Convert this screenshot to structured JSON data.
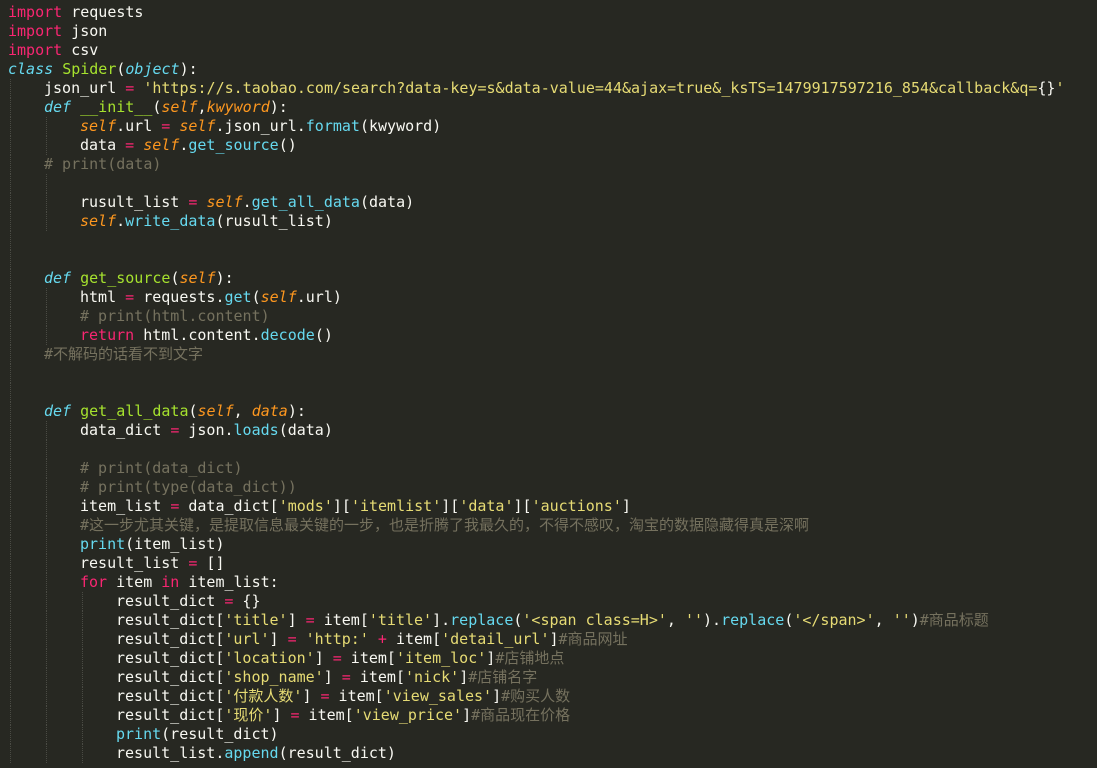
{
  "editor": {
    "theme": "monokai",
    "colors": {
      "background": "#272822",
      "plain": "#f8f8f2",
      "keyword": "#f92672",
      "string": "#e6db74",
      "comment": "#75715e",
      "function": "#a6e22e",
      "builtin": "#66d9ef",
      "parameter": "#fd971f"
    },
    "lines": [
      {
        "indent": 0,
        "tokens": [
          [
            "kw",
            "import"
          ],
          [
            "pl",
            " requests"
          ]
        ]
      },
      {
        "indent": 0,
        "tokens": [
          [
            "kw",
            "import"
          ],
          [
            "pl",
            " json"
          ]
        ]
      },
      {
        "indent": 0,
        "tokens": [
          [
            "kw",
            "import"
          ],
          [
            "pl",
            " csv"
          ]
        ]
      },
      {
        "indent": 0,
        "tokens": [
          [
            "df",
            "class"
          ],
          [
            "pl",
            " "
          ],
          [
            "fn",
            "Spider"
          ],
          [
            "pl",
            "("
          ],
          [
            "ty",
            "object"
          ],
          [
            "pl",
            "):"
          ]
        ]
      },
      {
        "indent": 1,
        "tokens": [
          [
            "pl",
            "json_url "
          ],
          [
            "op",
            "="
          ],
          [
            "pl",
            " "
          ],
          [
            "st",
            "'https://s.taobao.com/search?data-key=s&data-value=44&ajax=true&_ksTS=1479917597216_854&callback&q="
          ],
          [
            "pl",
            "{}"
          ],
          [
            "st",
            "'"
          ]
        ]
      },
      {
        "indent": 1,
        "tokens": [
          [
            "df",
            "def"
          ],
          [
            "pl",
            " "
          ],
          [
            "fn",
            "__init__"
          ],
          [
            "pl",
            "("
          ],
          [
            "sf",
            "self"
          ],
          [
            "pl",
            ","
          ],
          [
            "pa",
            "kwyword"
          ],
          [
            "pl",
            "):"
          ]
        ]
      },
      {
        "indent": 2,
        "tokens": [
          [
            "sf",
            "self"
          ],
          [
            "pl",
            ".url "
          ],
          [
            "op",
            "="
          ],
          [
            "pl",
            " "
          ],
          [
            "sf",
            "self"
          ],
          [
            "pl",
            ".json_url."
          ],
          [
            "bi",
            "format"
          ],
          [
            "pl",
            "(kwyword)"
          ]
        ]
      },
      {
        "indent": 2,
        "tokens": [
          [
            "pl",
            "data "
          ],
          [
            "op",
            "="
          ],
          [
            "pl",
            " "
          ],
          [
            "sf",
            "self"
          ],
          [
            "pl",
            "."
          ],
          [
            "bi",
            "get_source"
          ],
          [
            "pl",
            "()"
          ]
        ]
      },
      {
        "indent": 1,
        "tokens": [
          [
            "cm",
            "# print(data)"
          ]
        ]
      },
      {
        "indent": 2,
        "tokens": []
      },
      {
        "indent": 2,
        "tokens": [
          [
            "pl",
            "rusult_list "
          ],
          [
            "op",
            "="
          ],
          [
            "pl",
            " "
          ],
          [
            "sf",
            "self"
          ],
          [
            "pl",
            "."
          ],
          [
            "bi",
            "get_all_data"
          ],
          [
            "pl",
            "(data)"
          ]
        ]
      },
      {
        "indent": 2,
        "tokens": [
          [
            "sf",
            "self"
          ],
          [
            "pl",
            "."
          ],
          [
            "bi",
            "write_data"
          ],
          [
            "pl",
            "(rusult_list)"
          ]
        ]
      },
      {
        "indent": 1,
        "tokens": []
      },
      {
        "indent": 1,
        "tokens": []
      },
      {
        "indent": 1,
        "tokens": [
          [
            "df",
            "def"
          ],
          [
            "pl",
            " "
          ],
          [
            "fn",
            "get_source"
          ],
          [
            "pl",
            "("
          ],
          [
            "sf",
            "self"
          ],
          [
            "pl",
            "):"
          ]
        ]
      },
      {
        "indent": 2,
        "tokens": [
          [
            "pl",
            "html "
          ],
          [
            "op",
            "="
          ],
          [
            "pl",
            " requests."
          ],
          [
            "bi",
            "get"
          ],
          [
            "pl",
            "("
          ],
          [
            "sf",
            "self"
          ],
          [
            "pl",
            ".url)"
          ]
        ]
      },
      {
        "indent": 2,
        "tokens": [
          [
            "cm",
            "# print(html.content)"
          ]
        ]
      },
      {
        "indent": 2,
        "tokens": [
          [
            "kw",
            "return"
          ],
          [
            "pl",
            " html.content."
          ],
          [
            "bi",
            "decode"
          ],
          [
            "pl",
            "()"
          ]
        ]
      },
      {
        "indent": 1,
        "tokens": [
          [
            "cm",
            "#不解码的话看不到文字"
          ]
        ]
      },
      {
        "indent": 1,
        "tokens": []
      },
      {
        "indent": 1,
        "tokens": []
      },
      {
        "indent": 1,
        "tokens": [
          [
            "df",
            "def"
          ],
          [
            "pl",
            " "
          ],
          [
            "fn",
            "get_all_data"
          ],
          [
            "pl",
            "("
          ],
          [
            "sf",
            "self"
          ],
          [
            "pl",
            ", "
          ],
          [
            "pa",
            "data"
          ],
          [
            "pl",
            "):"
          ]
        ]
      },
      {
        "indent": 2,
        "tokens": [
          [
            "pl",
            "data_dict "
          ],
          [
            "op",
            "="
          ],
          [
            "pl",
            " json."
          ],
          [
            "bi",
            "loads"
          ],
          [
            "pl",
            "(data)"
          ]
        ]
      },
      {
        "indent": 2,
        "tokens": []
      },
      {
        "indent": 2,
        "tokens": [
          [
            "cm",
            "# print(data_dict)"
          ]
        ]
      },
      {
        "indent": 2,
        "tokens": [
          [
            "cm",
            "# print(type(data_dict))"
          ]
        ]
      },
      {
        "indent": 2,
        "tokens": [
          [
            "pl",
            "item_list "
          ],
          [
            "op",
            "="
          ],
          [
            "pl",
            " data_dict["
          ],
          [
            "st",
            "'mods'"
          ],
          [
            "pl",
            "]["
          ],
          [
            "st",
            "'itemlist'"
          ],
          [
            "pl",
            "]["
          ],
          [
            "st",
            "'data'"
          ],
          [
            "pl",
            "]["
          ],
          [
            "st",
            "'auctions'"
          ],
          [
            "pl",
            "]"
          ]
        ]
      },
      {
        "indent": 2,
        "tokens": [
          [
            "cm",
            "#这一步尤其关键，是提取信息最关键的一步，也是折腾了我最久的，不得不感叹，淘宝的数据隐藏得真是深啊"
          ]
        ]
      },
      {
        "indent": 2,
        "tokens": [
          [
            "bi",
            "print"
          ],
          [
            "pl",
            "(item_list)"
          ]
        ]
      },
      {
        "indent": 2,
        "tokens": [
          [
            "pl",
            "result_list "
          ],
          [
            "op",
            "="
          ],
          [
            "pl",
            " []"
          ]
        ]
      },
      {
        "indent": 2,
        "tokens": [
          [
            "kw",
            "for"
          ],
          [
            "pl",
            " item "
          ],
          [
            "kw",
            "in"
          ],
          [
            "pl",
            " item_list:"
          ]
        ]
      },
      {
        "indent": 3,
        "tokens": [
          [
            "pl",
            "result_dict "
          ],
          [
            "op",
            "="
          ],
          [
            "pl",
            " {}"
          ]
        ]
      },
      {
        "indent": 3,
        "tokens": [
          [
            "pl",
            "result_dict["
          ],
          [
            "st",
            "'title'"
          ],
          [
            "pl",
            "] "
          ],
          [
            "op",
            "="
          ],
          [
            "pl",
            " item["
          ],
          [
            "st",
            "'title'"
          ],
          [
            "pl",
            "]."
          ],
          [
            "bi",
            "replace"
          ],
          [
            "pl",
            "("
          ],
          [
            "st",
            "'<span class=H>'"
          ],
          [
            "pl",
            ", "
          ],
          [
            "st",
            "''"
          ],
          [
            "pl",
            ")."
          ],
          [
            "bi",
            "replace"
          ],
          [
            "pl",
            "("
          ],
          [
            "st",
            "'</span>'"
          ],
          [
            "pl",
            ", "
          ],
          [
            "st",
            "''"
          ],
          [
            "pl",
            ")"
          ],
          [
            "cm",
            "#商品标题"
          ]
        ]
      },
      {
        "indent": 3,
        "tokens": [
          [
            "pl",
            "result_dict["
          ],
          [
            "st",
            "'url'"
          ],
          [
            "pl",
            "] "
          ],
          [
            "op",
            "="
          ],
          [
            "pl",
            " "
          ],
          [
            "st",
            "'http:'"
          ],
          [
            "pl",
            " "
          ],
          [
            "op",
            "+"
          ],
          [
            "pl",
            " item["
          ],
          [
            "st",
            "'detail_url'"
          ],
          [
            "pl",
            "]"
          ],
          [
            "cm",
            "#商品网址"
          ]
        ]
      },
      {
        "indent": 3,
        "tokens": [
          [
            "pl",
            "result_dict["
          ],
          [
            "st",
            "'location'"
          ],
          [
            "pl",
            "] "
          ],
          [
            "op",
            "="
          ],
          [
            "pl",
            " item["
          ],
          [
            "st",
            "'item_loc'"
          ],
          [
            "pl",
            "]"
          ],
          [
            "cm",
            "#店铺地点"
          ]
        ]
      },
      {
        "indent": 3,
        "tokens": [
          [
            "pl",
            "result_dict["
          ],
          [
            "st",
            "'shop_name'"
          ],
          [
            "pl",
            "] "
          ],
          [
            "op",
            "="
          ],
          [
            "pl",
            " item["
          ],
          [
            "st",
            "'nick'"
          ],
          [
            "pl",
            "]"
          ],
          [
            "cm",
            "#店铺名字"
          ]
        ]
      },
      {
        "indent": 3,
        "tokens": [
          [
            "pl",
            "result_dict["
          ],
          [
            "st",
            "'付款人数'"
          ],
          [
            "pl",
            "] "
          ],
          [
            "op",
            "="
          ],
          [
            "pl",
            " item["
          ],
          [
            "st",
            "'view_sales'"
          ],
          [
            "pl",
            "]"
          ],
          [
            "cm",
            "#购买人数"
          ]
        ]
      },
      {
        "indent": 3,
        "tokens": [
          [
            "pl",
            "result_dict["
          ],
          [
            "st",
            "'现价'"
          ],
          [
            "pl",
            "] "
          ],
          [
            "op",
            "="
          ],
          [
            "pl",
            " item["
          ],
          [
            "st",
            "'view_price'"
          ],
          [
            "pl",
            "]"
          ],
          [
            "cm",
            "#商品现在价格"
          ]
        ]
      },
      {
        "indent": 3,
        "tokens": [
          [
            "bi",
            "print"
          ],
          [
            "pl",
            "(result_dict)"
          ]
        ]
      },
      {
        "indent": 3,
        "tokens": [
          [
            "pl",
            "result_list."
          ],
          [
            "bi",
            "append"
          ],
          [
            "pl",
            "(result_dict)"
          ]
        ]
      }
    ]
  }
}
